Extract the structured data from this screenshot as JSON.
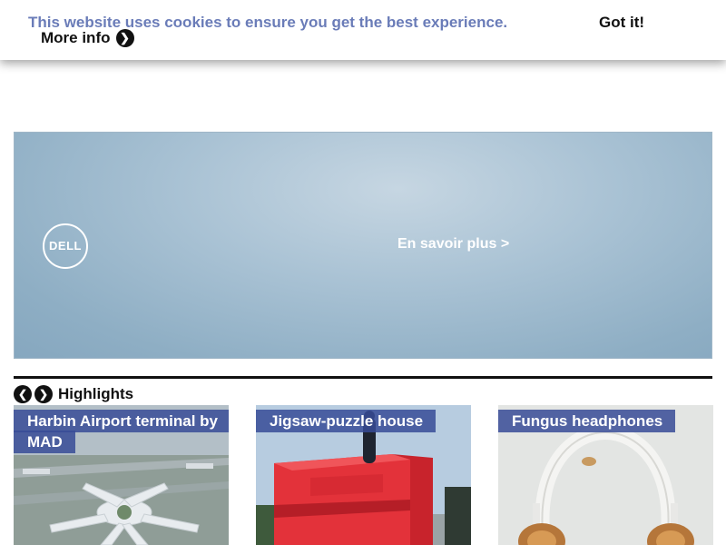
{
  "cookie_bar": {
    "message": "This website uses cookies to ensure you get the best experience.",
    "more_info": "More info",
    "more_info_icon": "❯",
    "accept": "Got it!"
  },
  "ad": {
    "logo_text": "DELL",
    "cta": "En savoir plus >"
  },
  "highlights": {
    "title": "Highlights",
    "prev_icon": "❮",
    "next_icon": "❯",
    "cards": [
      {
        "title": "Harbin Airport terminal by MAD"
      },
      {
        "title": "Jigsaw-puzzle house"
      },
      {
        "title": "Fungus headphones"
      }
    ]
  },
  "colors": {
    "cookie_text": "#6a7cb8",
    "label_bg": "#374b96"
  }
}
